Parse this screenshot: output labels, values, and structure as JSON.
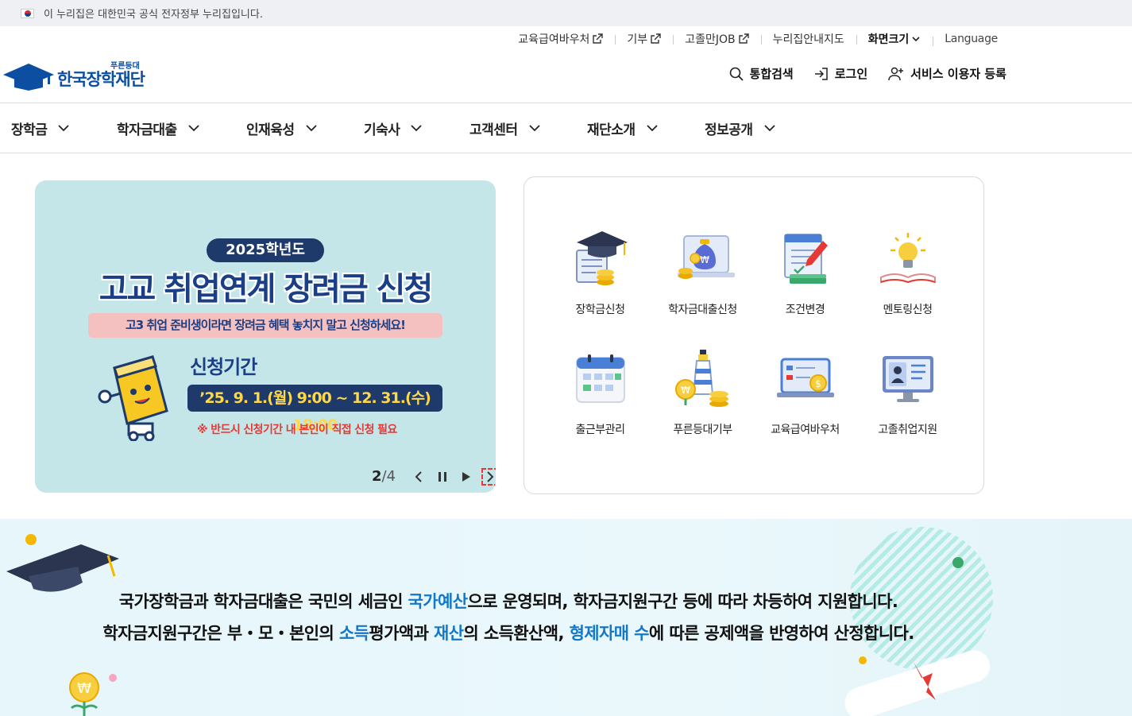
{
  "gov_banner": {
    "text": "이 누리집은 대한민국 공식 전자정부 누리집입니다."
  },
  "utility": {
    "edu_voucher": "교육급여바우처",
    "donate": "기부",
    "job": "고졸만JOB",
    "sitemap": "누리집안내지도",
    "font_size": "화면크기",
    "language": "Language"
  },
  "logo": {
    "small": "푸른등대",
    "main": "한국장학재단"
  },
  "actions": {
    "search": "통합검색",
    "login": "로그인",
    "register": "서비스 이용자 등록"
  },
  "gnb": [
    "장학금",
    "학자금대출",
    "인재육성",
    "기숙사",
    "고객센터",
    "재단소개",
    "정보공개"
  ],
  "banner": {
    "year": "2025학년도",
    "title": "고교 취업연계 장려금 신청",
    "subtitle": "고3 취업 준비생이라면 장려금 혜택 놓치지 말고 신청하세요!",
    "period_label": "신청기간",
    "period": "’25. 9. 1.(월) 9:00 ~ 12. 31.(수) 18:00",
    "note": "※ 반드시 신청기간 내 본인이 직접 신청 필요",
    "page_current": "2",
    "page_total": "/4"
  },
  "quick_menu": [
    "장학금신청",
    "학자금대출신청",
    "조건변경",
    "멘토링신청",
    "출근부관리",
    "푸른등대기부",
    "교육급여바우처",
    "고졸취업지원"
  ],
  "info": {
    "l1_a": "국가장학금과 학자금대출은 국민의 세금인 ",
    "l1_b": "국가예산",
    "l1_c": "으로 운영되며, 학자금지원구간 등에 따라 차등하여 지원합니다.",
    "l2_a": "학자금지원구간은 부・모・본인의 ",
    "l2_b": "소득",
    "l2_c": "평가액과 ",
    "l2_d": "재산",
    "l2_e": "의 소득환산액, ",
    "l2_f": "형제자매 수",
    "l2_g": "에 따른 공제액을 반영하여 산정합니다."
  },
  "colors": {
    "brand": "#0b4ea2",
    "highlight": "#1478c8",
    "banner_bg": "#c5e6e9"
  }
}
